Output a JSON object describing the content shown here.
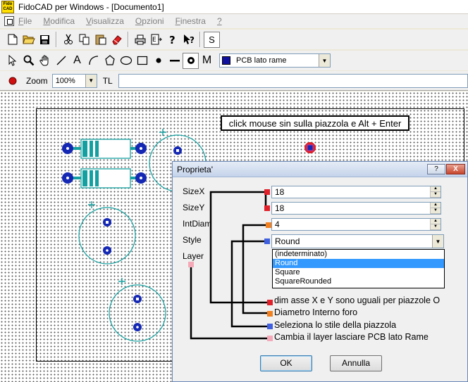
{
  "app": {
    "logo_text": "Fido CAD",
    "title": "FidoCAD per Windows - [Documento1]"
  },
  "menu": {
    "items": [
      {
        "first": "F",
        "rest": "ile"
      },
      {
        "first": "M",
        "rest": "odifica"
      },
      {
        "first": "V",
        "rest": "isualizza"
      },
      {
        "first": "O",
        "rest": "pzioni"
      },
      {
        "first": "F",
        "rest": "inestra"
      },
      {
        "first": "?",
        "rest": ""
      }
    ]
  },
  "toolbar_file": {
    "icons": [
      "new-file-icon",
      "open-folder-icon",
      "save-icon",
      "cut-icon",
      "copy-icon",
      "paste-icon",
      "eraser-icon",
      "print-icon",
      "export-icon",
      "help-icon",
      "context-help-icon"
    ],
    "snap_label": "S"
  },
  "toolbar_draw": {
    "text_tool_label": "A",
    "macro_tool_label": "M",
    "layer_name": "PCB lato rame",
    "layer_color": "#1010a0"
  },
  "toolbar_zoom": {
    "zoom_label": "Zoom",
    "zoom_value": "100%",
    "tl_label": "TL",
    "tl_value": ""
  },
  "canvas": {
    "hint": "click mouse sin sulla piazzola e Alt + Enter",
    "pad_color": "#1428b4",
    "trace_color": "#14a0a0",
    "plus_color": "#14a0a0"
  },
  "dialog": {
    "title": "Proprieta'",
    "help_label": "?",
    "close_label": "X",
    "labels": {
      "sizex": "SizeX",
      "sizey": "SizeY",
      "intdiam": "IntDiam",
      "style": "Style",
      "layer": "Layer"
    },
    "sizex_value": "18",
    "sizey_value": "18",
    "intdiam_value": "4",
    "style_value": "Round",
    "style_options": [
      "(indeterminato)",
      "Round",
      "Square",
      "SquareRounded"
    ],
    "style_selected_index": 1,
    "descriptions": {
      "dims": "dim asse X e Y sono uguali per piazzole O",
      "intdiam": "Diametro Interno  foro",
      "style": "Seleziona lo stile della piazzola",
      "layer": "Cambia il layer lasciare PCB lato Rame"
    },
    "marker_colors": {
      "size": "#e0202a",
      "intdiam": "#f08020",
      "style": "#4060e0",
      "layer": "#f4a8b8"
    },
    "ok_label": "OK",
    "cancel_label": "Annulla"
  }
}
